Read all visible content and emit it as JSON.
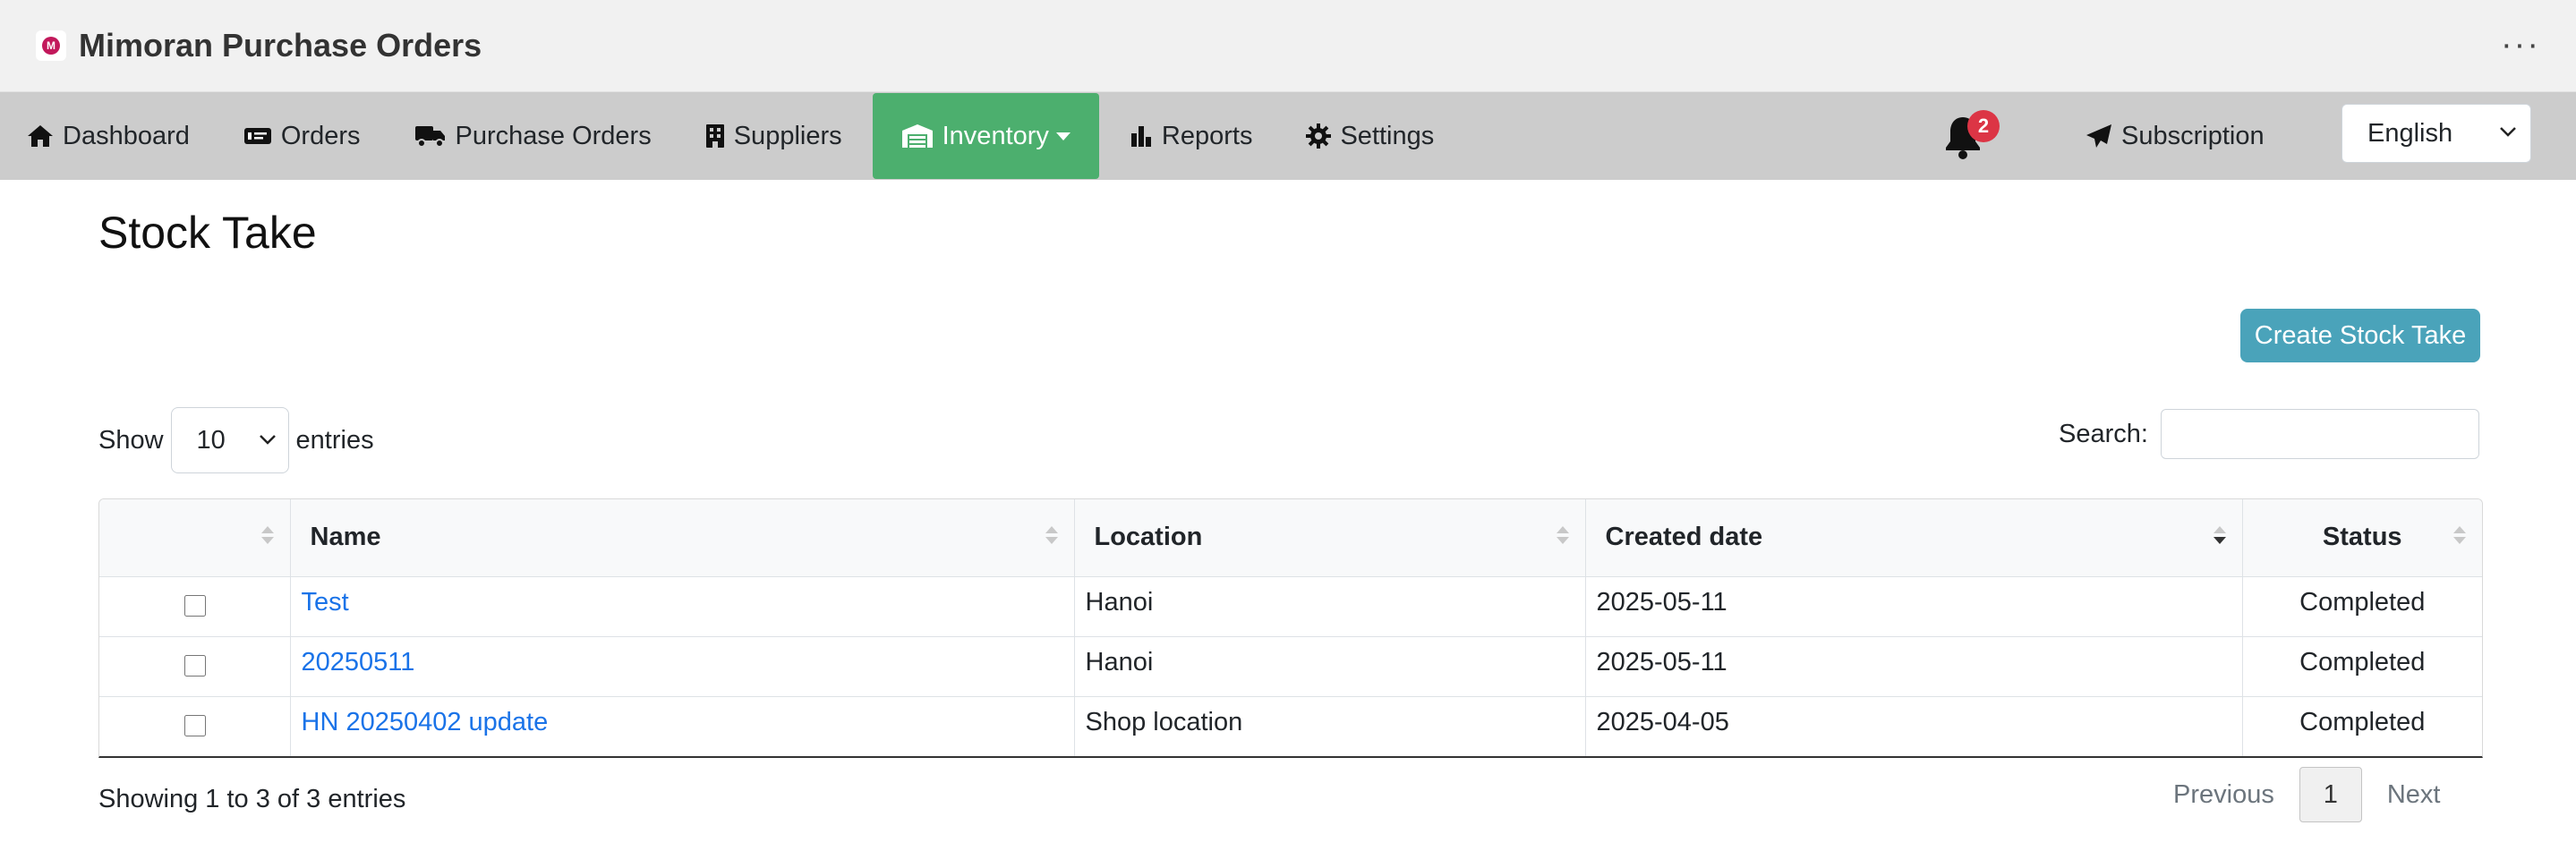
{
  "app": {
    "title": "Mimoran Purchase Orders"
  },
  "nav": {
    "dashboard": "Dashboard",
    "orders": "Orders",
    "purchase_orders": "Purchase Orders",
    "suppliers": "Suppliers",
    "inventory": "Inventory",
    "reports": "Reports",
    "settings": "Settings",
    "notification_count": "2",
    "subscription": "Subscription",
    "language": "English"
  },
  "page": {
    "title": "Stock Take",
    "create_button": "Create Stock Take",
    "show_label": "Show",
    "entries_value": "10",
    "entries_label": "entries",
    "search_label": "Search:",
    "search_value": ""
  },
  "table": {
    "columns": [
      "",
      "Name",
      "Location",
      "Created date",
      "Status"
    ],
    "rows": [
      {
        "name": "Test",
        "location": "Hanoi",
        "created": "2025-05-11",
        "status": "Completed"
      },
      {
        "name": "20250511",
        "location": "Hanoi",
        "created": "2025-05-11",
        "status": "Completed"
      },
      {
        "name": "HN 20250402 update",
        "location": "Shop location",
        "created": "2025-04-05",
        "status": "Completed"
      }
    ]
  },
  "footer": {
    "info": "Showing 1 to 3 of 3 entries",
    "previous": "Previous",
    "page": "1",
    "next": "Next"
  },
  "colors": {
    "active_nav": "#4caf6e",
    "button": "#4aa3ba",
    "link": "#1a73e8",
    "badge": "#dc3545"
  }
}
